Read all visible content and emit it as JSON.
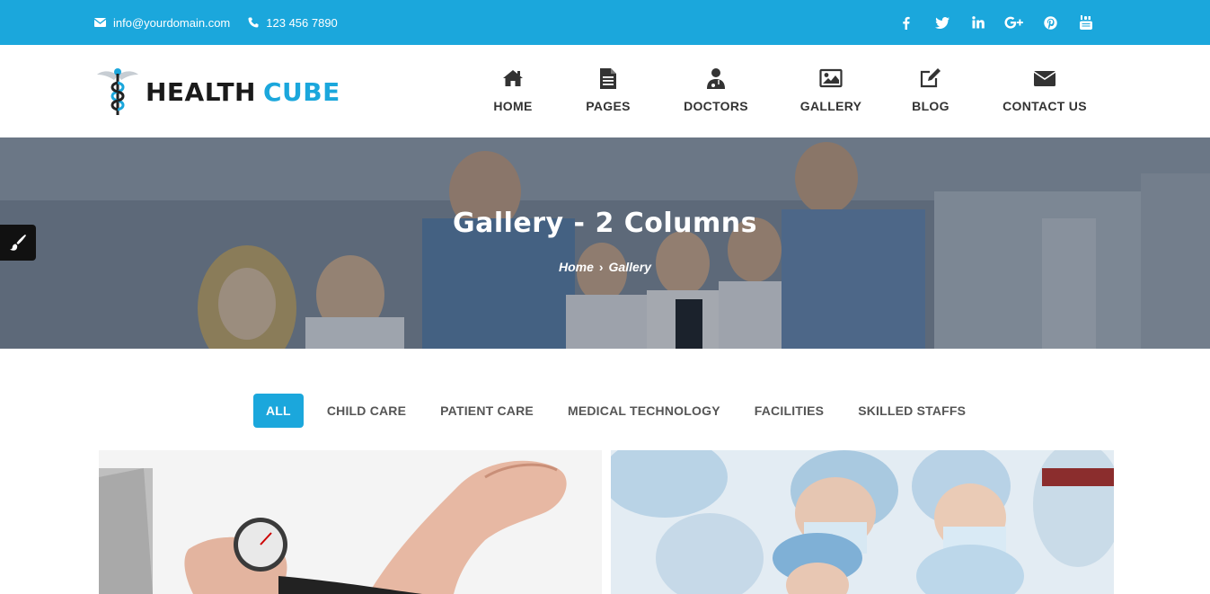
{
  "topbar": {
    "email": "info@yourdomain.com",
    "phone": "123 456 7890",
    "social": [
      "facebook-icon",
      "twitter-icon",
      "linkedin-icon",
      "google-plus-icon",
      "pinterest-icon",
      "youtube-icon"
    ],
    "background_color": "#1ba7dc"
  },
  "brand": {
    "word1": "HEALTH",
    "word2": "CUBE",
    "accent_color": "#1ba7dc"
  },
  "nav": {
    "items": [
      {
        "label": "HOME",
        "icon": "home-icon"
      },
      {
        "label": "PAGES",
        "icon": "document-icon"
      },
      {
        "label": "DOCTORS",
        "icon": "doctor-icon"
      },
      {
        "label": "GALLERY",
        "icon": "image-icon"
      },
      {
        "label": "BLOG",
        "icon": "edit-icon"
      },
      {
        "label": "CONTACT US",
        "icon": "envelope-icon"
      }
    ]
  },
  "hero": {
    "title": "Gallery - 2 Columns",
    "breadcrumb": {
      "home": "Home",
      "separator": "›",
      "current": "Gallery"
    }
  },
  "filters": {
    "items": [
      "ALL",
      "CHILD CARE",
      "PATIENT CARE",
      "MEDICAL TECHNOLOGY",
      "FACILITIES",
      "SKILLED STAFFS"
    ],
    "active": "ALL"
  }
}
